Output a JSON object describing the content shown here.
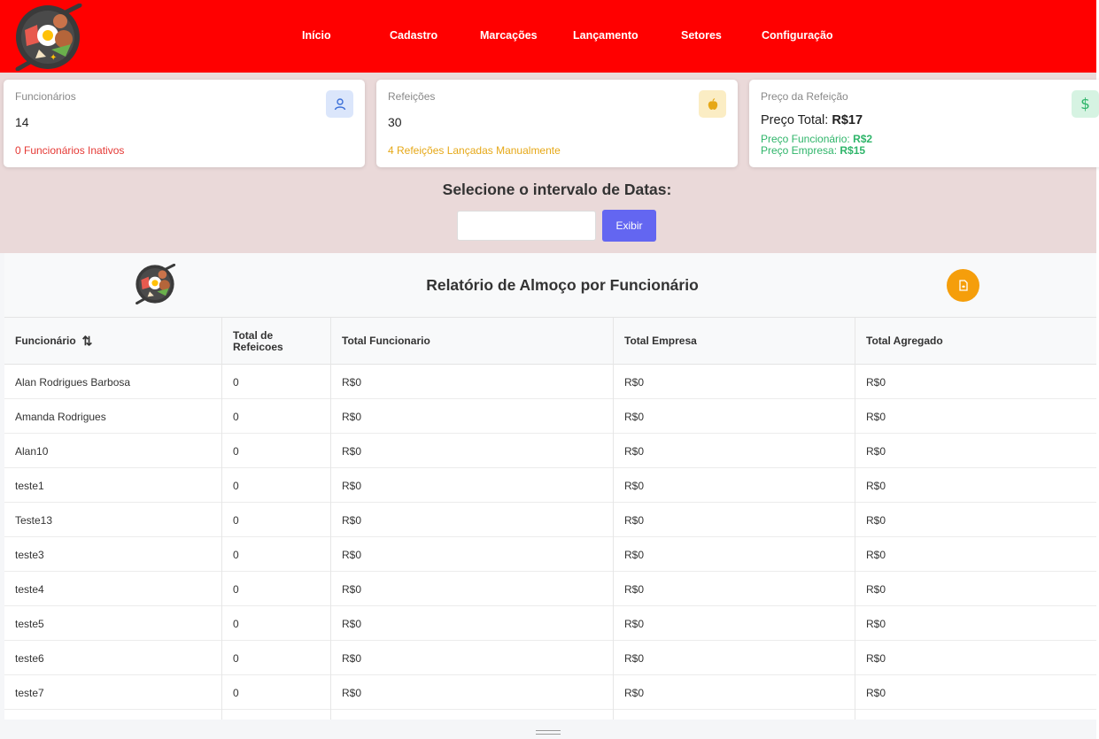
{
  "nav": {
    "items": [
      {
        "label": "Início"
      },
      {
        "label": "Cadastro"
      },
      {
        "label": "Marcações"
      },
      {
        "label": "Lançamento"
      },
      {
        "label": "Setores"
      },
      {
        "label": "Configuração"
      }
    ]
  },
  "cards": {
    "funcionarios": {
      "title": "Funcionários",
      "value": "14",
      "sub": "0 Funcionários Inativos",
      "sub_color": "#e53935",
      "icon": "user-icon"
    },
    "refeicoes": {
      "title": "Refeições",
      "value": "30",
      "sub": "4 Refeições Lançadas Manualmente",
      "sub_color": "#e6a817",
      "icon": "apple-icon"
    },
    "preco": {
      "title": "Preço da Refeição",
      "total_label": "Preço Total: ",
      "total_value": "R$17",
      "func_label": "Preço Funcionário: ",
      "func_value": "R$2",
      "emp_label": "Preço Empresa: ",
      "emp_value": "R$15",
      "accent": "#2fb56a",
      "icon": "dollar-icon"
    }
  },
  "date_filter": {
    "title": "Selecione o intervalo de Datas:",
    "input_value": "",
    "button_label": "Exibir"
  },
  "report": {
    "title": "Relatório de Almoço por Funcionário",
    "pdf_icon": "file-pdf-icon",
    "columns": {
      "funcionario": "Funcionário",
      "total_refeicoes": "Total de Refeicoes",
      "total_funcionario": "Total Funcionario",
      "total_empresa": "Total Empresa",
      "total_agregado": "Total Agregado"
    },
    "rows": [
      {
        "name": "Alan Rodrigues Barbosa",
        "refeicoes": "0",
        "func": "R$0",
        "emp": "R$0",
        "agreg": "R$0"
      },
      {
        "name": "Amanda Rodrigues",
        "refeicoes": "0",
        "func": "R$0",
        "emp": "R$0",
        "agreg": "R$0"
      },
      {
        "name": "Alan10",
        "refeicoes": "0",
        "func": "R$0",
        "emp": "R$0",
        "agreg": "R$0"
      },
      {
        "name": "teste1",
        "refeicoes": "0",
        "func": "R$0",
        "emp": "R$0",
        "agreg": "R$0"
      },
      {
        "name": "Teste13",
        "refeicoes": "0",
        "func": "R$0",
        "emp": "R$0",
        "agreg": "R$0"
      },
      {
        "name": "teste3",
        "refeicoes": "0",
        "func": "R$0",
        "emp": "R$0",
        "agreg": "R$0"
      },
      {
        "name": "teste4",
        "refeicoes": "0",
        "func": "R$0",
        "emp": "R$0",
        "agreg": "R$0"
      },
      {
        "name": "teste5",
        "refeicoes": "0",
        "func": "R$0",
        "emp": "R$0",
        "agreg": "R$0"
      },
      {
        "name": "teste6",
        "refeicoes": "0",
        "func": "R$0",
        "emp": "R$0",
        "agreg": "R$0"
      },
      {
        "name": "teste7",
        "refeicoes": "0",
        "func": "R$0",
        "emp": "R$0",
        "agreg": "R$0"
      }
    ]
  },
  "colors": {
    "navbar": "#ff0000",
    "band": "#ead9d9",
    "button": "#6366f1",
    "pdf_button": "#f59e0b"
  }
}
